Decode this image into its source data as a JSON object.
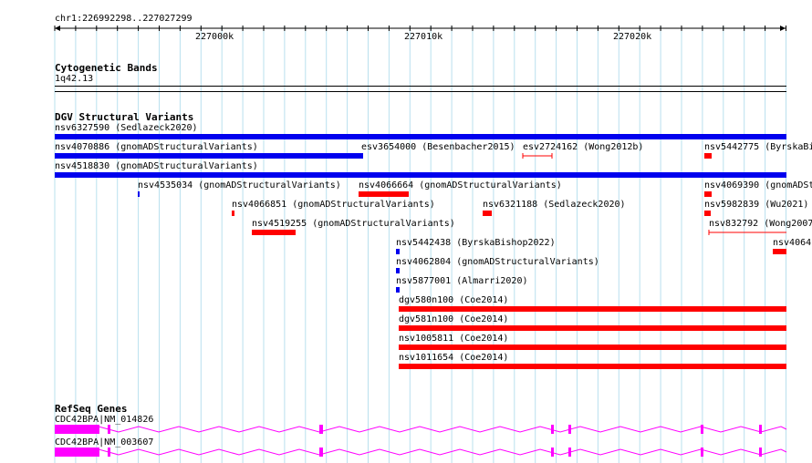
{
  "ruler": {
    "location": "chr1:226992298..227027299",
    "ticks": [
      "227000k",
      "227010k",
      "227020k"
    ]
  },
  "tracks": {
    "cytoband": {
      "title": "Cytogenetic Bands",
      "band": "1q42.13"
    },
    "dgv": {
      "title": "DGV Structural Variants",
      "labels": [
        "nsv6327590 (Sedlazeck2020)",
        "nsv4070886 (gnomADStructuralVariants)",
        "esv3654000 (Besenbacher2015)",
        "esv2724162 (Wong2012b)",
        "nsv5442775 (ByrskaBi",
        "nsv4518830 (gnomADStructuralVariants)",
        "nsv4535034 (gnomADStructuralVariants)",
        "nsv4066664 (gnomADStructuralVariants)",
        "nsv4069390 (gnomADSt",
        "nsv4066851 (gnomADStructuralVariants)",
        "nsv6321188 (Sedlazeck2020)",
        "nsv5982839 (Wu2021)",
        "nsv4519255 (gnomADStructuralVariants)",
        "nsv832792 (Wong2007",
        "nsv5442438 (ByrskaBishop2022)",
        "nsv4064",
        "nsv4062804 (gnomADStructuralVariants)",
        "nsv5877001 (Almarri2020)",
        "dgv580n100 (Coe2014)",
        "dgv581n100 (Coe2014)",
        "nsv1005811 (Coe2014)",
        "nsv1011654 (Coe2014)"
      ]
    },
    "refseq": {
      "title": "RefSeq Genes",
      "genes": [
        "CDC42BPA|NM_014826",
        "CDC42BPA|NM_003607"
      ]
    }
  },
  "colors": {
    "gain": "#0000ee",
    "loss": "#ff0000",
    "gene": "#ff00ff",
    "grid": "#b9e0ee"
  }
}
